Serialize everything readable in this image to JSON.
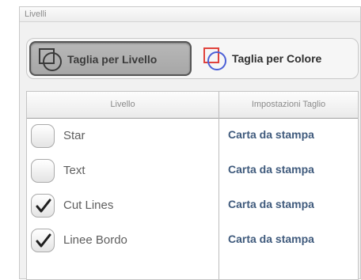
{
  "panel": {
    "title": "Livelli"
  },
  "toggle": {
    "by_layer_label": "Taglia per Livello",
    "by_color_label": "Taglia per Colore"
  },
  "table": {
    "columns": [
      "Livello",
      "Impostazioni Taglio"
    ],
    "rows": [
      {
        "name": "Star",
        "setting": "Carta da stampa",
        "checked": false
      },
      {
        "name": "Text",
        "setting": "Carta da stampa",
        "checked": false
      },
      {
        "name": "Cut Lines",
        "setting": "Carta da stampa",
        "checked": true
      },
      {
        "name": "Linee Bordo",
        "setting": "Carta da stampa",
        "checked": true
      }
    ]
  },
  "icons": {
    "by_layer": "layers-icon",
    "by_color": "color-layers-icon",
    "check": "checkmark-icon"
  },
  "colors": {
    "setting_text": "#3f5a7c",
    "color_icon_red": "#e0423c",
    "color_icon_blue": "#4b5fd6"
  }
}
